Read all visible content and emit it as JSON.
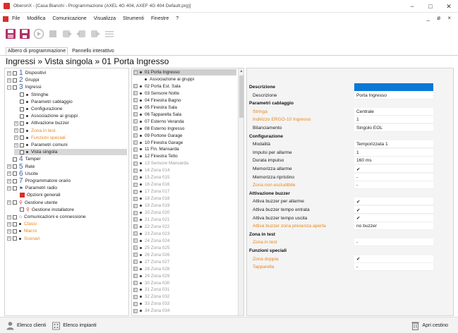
{
  "window": {
    "title": "OberonX - [Casa Bianchi - Programmazione (AXEL 4G 404, AXEF 4G 404 Default.prg)]",
    "minimize": "−",
    "maximize": "□",
    "close": "✕"
  },
  "menu": {
    "items": [
      "File",
      "Modifica",
      "Comunicazione",
      "Visualizza",
      "Strumenti",
      "Finestre",
      "?"
    ],
    "right_controls": "_ ø ×"
  },
  "toolbar": {
    "icons": [
      "save-as-icon",
      "save-icon",
      "play-icon",
      "stop-icon",
      "upload-icon",
      "download-icon",
      "send-icon",
      "list-icon"
    ]
  },
  "tabs": {
    "programming_tree": "Albero di programmazione",
    "interactive_panel": "Pannello interattivo"
  },
  "breadcrumb": "Ingressi » Vista singola » 01 Porta Ingresso",
  "left_tree": [
    {
      "level": 0,
      "exp": "+",
      "cb": true,
      "num": "1",
      "label": "Dispositivi",
      "color": ""
    },
    {
      "level": 0,
      "exp": "+",
      "cb": true,
      "num": "2",
      "label": "Gruppi",
      "color": ""
    },
    {
      "level": 0,
      "exp": "−",
      "cb": true,
      "num": "3",
      "label": "Ingressi",
      "color": ""
    },
    {
      "level": 1,
      "exp": "",
      "cb": true,
      "num": "",
      "bullet": true,
      "label": "Stringhe",
      "color": ""
    },
    {
      "level": 1,
      "exp": "",
      "cb": true,
      "num": "",
      "bullet": true,
      "label": "Parametri cablaggio",
      "color": ""
    },
    {
      "level": 1,
      "exp": "",
      "cb": true,
      "num": "",
      "bullet": true,
      "label": "Configurazione",
      "color": ""
    },
    {
      "level": 1,
      "exp": "",
      "cb": true,
      "num": "",
      "bullet": true,
      "label": "Associazione ai gruppi",
      "color": ""
    },
    {
      "level": 1,
      "exp": "+",
      "cb": true,
      "num": "",
      "bullet": true,
      "label": "Attivazione buzzer",
      "color": ""
    },
    {
      "level": 1,
      "exp": "+",
      "cb": true,
      "num": "",
      "bullet": true,
      "label": "Zona in test",
      "color": "orange"
    },
    {
      "level": 1,
      "exp": "+",
      "cb": true,
      "num": "",
      "bullet": true,
      "label": "Funzioni speciali",
      "color": "orange"
    },
    {
      "level": 1,
      "exp": "+",
      "cb": true,
      "num": "",
      "bullet": true,
      "label": "Parametri comuni",
      "color": ""
    },
    {
      "level": 1,
      "exp": "",
      "cb": true,
      "num": "",
      "bullet": true,
      "label": "Vista singola",
      "color": "",
      "selected": true
    },
    {
      "level": 0,
      "exp": "",
      "cb": true,
      "num": "4",
      "label": "Tamper",
      "color": ""
    },
    {
      "level": 0,
      "exp": "+",
      "cb": true,
      "num": "5",
      "label": "Relè",
      "color": ""
    },
    {
      "level": 0,
      "exp": "+",
      "cb": true,
      "num": "6",
      "label": "Uscite",
      "color": ""
    },
    {
      "level": 0,
      "exp": "+",
      "cb": true,
      "num": "7",
      "label": "Programmatore orario",
      "color": ""
    },
    {
      "level": 0,
      "exp": "+",
      "cb": true,
      "num": "",
      "flag": true,
      "label": "Parametri radio",
      "color": ""
    },
    {
      "level": 1,
      "exp": "",
      "cb": false,
      "num": "",
      "book": true,
      "label": "Opzioni generali",
      "color": ""
    },
    {
      "level": 0,
      "exp": "+",
      "cb": true,
      "num": "",
      "user": true,
      "label": "Gestione utente",
      "color": ""
    },
    {
      "level": 1,
      "exp": "",
      "cb": true,
      "num": "",
      "user": true,
      "label": "Gestione installatore",
      "color": ""
    },
    {
      "level": 0,
      "exp": "+",
      "cb": true,
      "num": "",
      "net": true,
      "label": "Comunicazioni e connessione",
      "color": ""
    },
    {
      "level": 0,
      "exp": "+",
      "cb": true,
      "num": "",
      "bullet": true,
      "label": "Classi",
      "color": "orange"
    },
    {
      "level": 0,
      "exp": "+",
      "cb": true,
      "num": "",
      "bullet": true,
      "label": "Macro",
      "color": "orange"
    },
    {
      "level": 0,
      "exp": "+",
      "cb": true,
      "num": "",
      "bullet": true,
      "label": "Scenari",
      "color": "orange"
    }
  ],
  "mid_list": [
    {
      "label": "01 Porta Ingresso",
      "dim": false,
      "sel": true,
      "exp": "−"
    },
    {
      "label": "Associazione ai gruppi",
      "dim": false,
      "child": true
    },
    {
      "label": "02 Porta Est. Sala",
      "dim": false
    },
    {
      "label": "03 Sensore Notte",
      "dim": false
    },
    {
      "label": "04 Finestra Bagno",
      "dim": false
    },
    {
      "label": "05 Finestra Sala",
      "dim": false
    },
    {
      "label": "06 Tapparella Sala",
      "dim": false
    },
    {
      "label": "07 Esterno Veranda",
      "dim": false
    },
    {
      "label": "08 Esterno Ingresso",
      "dim": false
    },
    {
      "label": "09 Portone Garage",
      "dim": false
    },
    {
      "label": "10 Finestra Garage",
      "dim": false
    },
    {
      "label": "11 Fin. Mansarda",
      "dim": false
    },
    {
      "label": "12 Finestra Tetto",
      "dim": false
    },
    {
      "label": "13 Sensore Mansarda",
      "dim": true
    },
    {
      "label": "14 Zona 014",
      "dim": true
    },
    {
      "label": "15 Zona 015",
      "dim": true
    },
    {
      "label": "16 Zona 016",
      "dim": true
    },
    {
      "label": "17 Zona 017",
      "dim": true
    },
    {
      "label": "18 Zona 018",
      "dim": true
    },
    {
      "label": "19 Zona 019",
      "dim": true
    },
    {
      "label": "20 Zona 020",
      "dim": true
    },
    {
      "label": "21 Zona 021",
      "dim": true
    },
    {
      "label": "22 Zona 022",
      "dim": true
    },
    {
      "label": "23 Zona 023",
      "dim": true
    },
    {
      "label": "24 Zona 024",
      "dim": true
    },
    {
      "label": "25 Zona 025",
      "dim": true
    },
    {
      "label": "26 Zona 026",
      "dim": true
    },
    {
      "label": "27 Zona 027",
      "dim": true
    },
    {
      "label": "28 Zona 028",
      "dim": true
    },
    {
      "label": "29 Zona 029",
      "dim": true
    },
    {
      "label": "30 Zona 030",
      "dim": true
    },
    {
      "label": "31 Zona 031",
      "dim": true
    },
    {
      "label": "32 Zona 032",
      "dim": true
    },
    {
      "label": "33 Zona 033",
      "dim": true
    },
    {
      "label": "34 Zona 034",
      "dim": true
    }
  ],
  "properties": [
    {
      "type": "section",
      "key": "Descrizione",
      "value": "",
      "blue": true
    },
    {
      "type": "item",
      "key": "Descrizione",
      "value": "Porta Ingresso"
    },
    {
      "type": "section",
      "key": "Parametri cablaggio",
      "value": ""
    },
    {
      "type": "item",
      "key": "Stringa",
      "value": "Centrale",
      "orange": true
    },
    {
      "type": "item",
      "key": "Indirizzo ERGO-10 Ingresso",
      "value": "1",
      "orange": true
    },
    {
      "type": "item",
      "key": "Bilanciamento",
      "value": "Singolo EOL"
    },
    {
      "type": "section",
      "key": "Configurazione",
      "value": ""
    },
    {
      "type": "item",
      "key": "Modalità",
      "value": "Temporizzata 1"
    },
    {
      "type": "item",
      "key": "Impulsi per allarme",
      "value": "1"
    },
    {
      "type": "item",
      "key": "Durata impulso",
      "value": "160 ms"
    },
    {
      "type": "item",
      "key": "Memorizza allarme",
      "value": "✔"
    },
    {
      "type": "item",
      "key": "Memorizza ripristino",
      "value": "-"
    },
    {
      "type": "item",
      "key": "Zona non escludibile",
      "value": "-",
      "orange": true
    },
    {
      "type": "section",
      "key": "Attivazione buzzer",
      "value": ""
    },
    {
      "type": "item",
      "key": "Attiva buzzer per allarme",
      "value": "✔"
    },
    {
      "type": "item",
      "key": "Attiva buzzer tempo entrata",
      "value": "✔"
    },
    {
      "type": "item",
      "key": "Attiva buzzer tempo uscita",
      "value": "✔"
    },
    {
      "type": "item",
      "key": "Attiva buzzer zona presenza aperta",
      "value": "no buzzer",
      "orange": true
    },
    {
      "type": "section",
      "key": "Zona in test",
      "value": ""
    },
    {
      "type": "item",
      "key": "Zona in test",
      "value": "-",
      "orange": true
    },
    {
      "type": "section",
      "key": "Funzioni speciali",
      "value": ""
    },
    {
      "type": "item",
      "key": "Zona doppia",
      "value": "✔",
      "orange": true
    },
    {
      "type": "item",
      "key": "Tapparella",
      "value": "-",
      "orange": true
    }
  ],
  "statusbar": {
    "clients": "Elenco clienti",
    "systems": "Elenco impianti",
    "trash": "Apri cestino"
  },
  "colors": {
    "accent_blue": "#0a78d7",
    "brand_red": "#d7302a",
    "orange_text": "#e8861b",
    "icon_blue": "#3a5ba8"
  }
}
